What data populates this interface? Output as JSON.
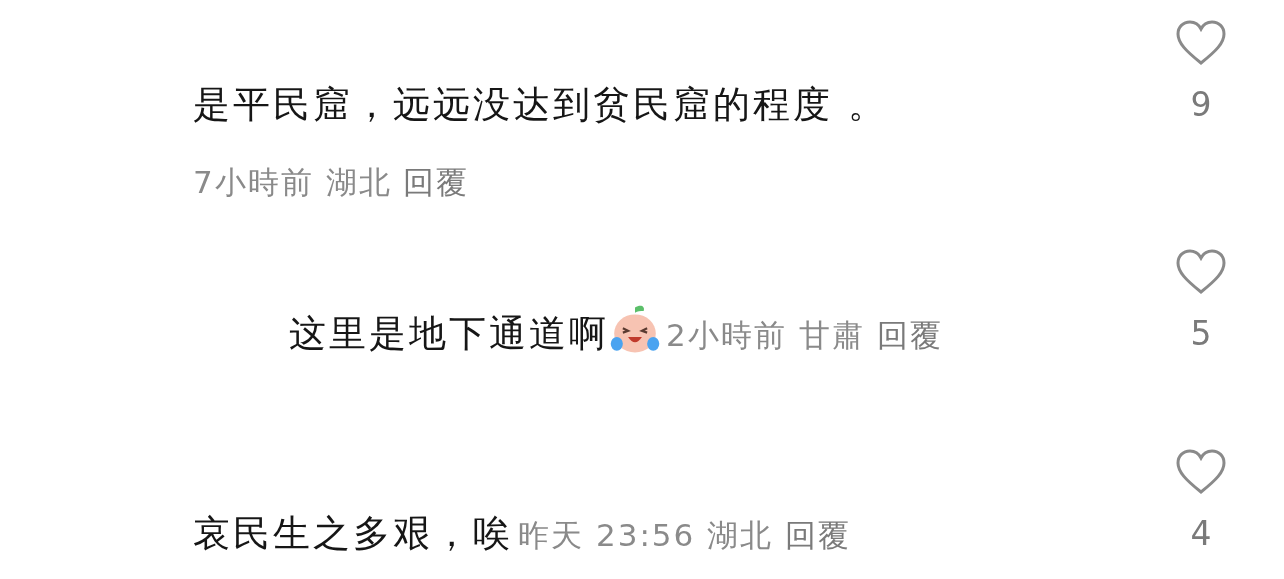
{
  "comments": [
    {
      "kind": "comment",
      "text": "是平民窟，远远没达到贫民窟的程度 。",
      "emoji": false,
      "time": "7小時前",
      "location": "湖北",
      "reply": "回覆",
      "likes": "9",
      "liked": false
    },
    {
      "kind": "reply",
      "text": "这里是地下通道啊",
      "emoji": true,
      "time": "2小時前",
      "location": "甘肅",
      "reply": "回覆",
      "likes": "5",
      "liked": false
    },
    {
      "kind": "comment",
      "text": "哀民生之多艰，唉",
      "emoji": false,
      "time": "昨天 23:56",
      "location": "湖北",
      "reply": "回覆",
      "likes": "4",
      "liked": false
    }
  ]
}
